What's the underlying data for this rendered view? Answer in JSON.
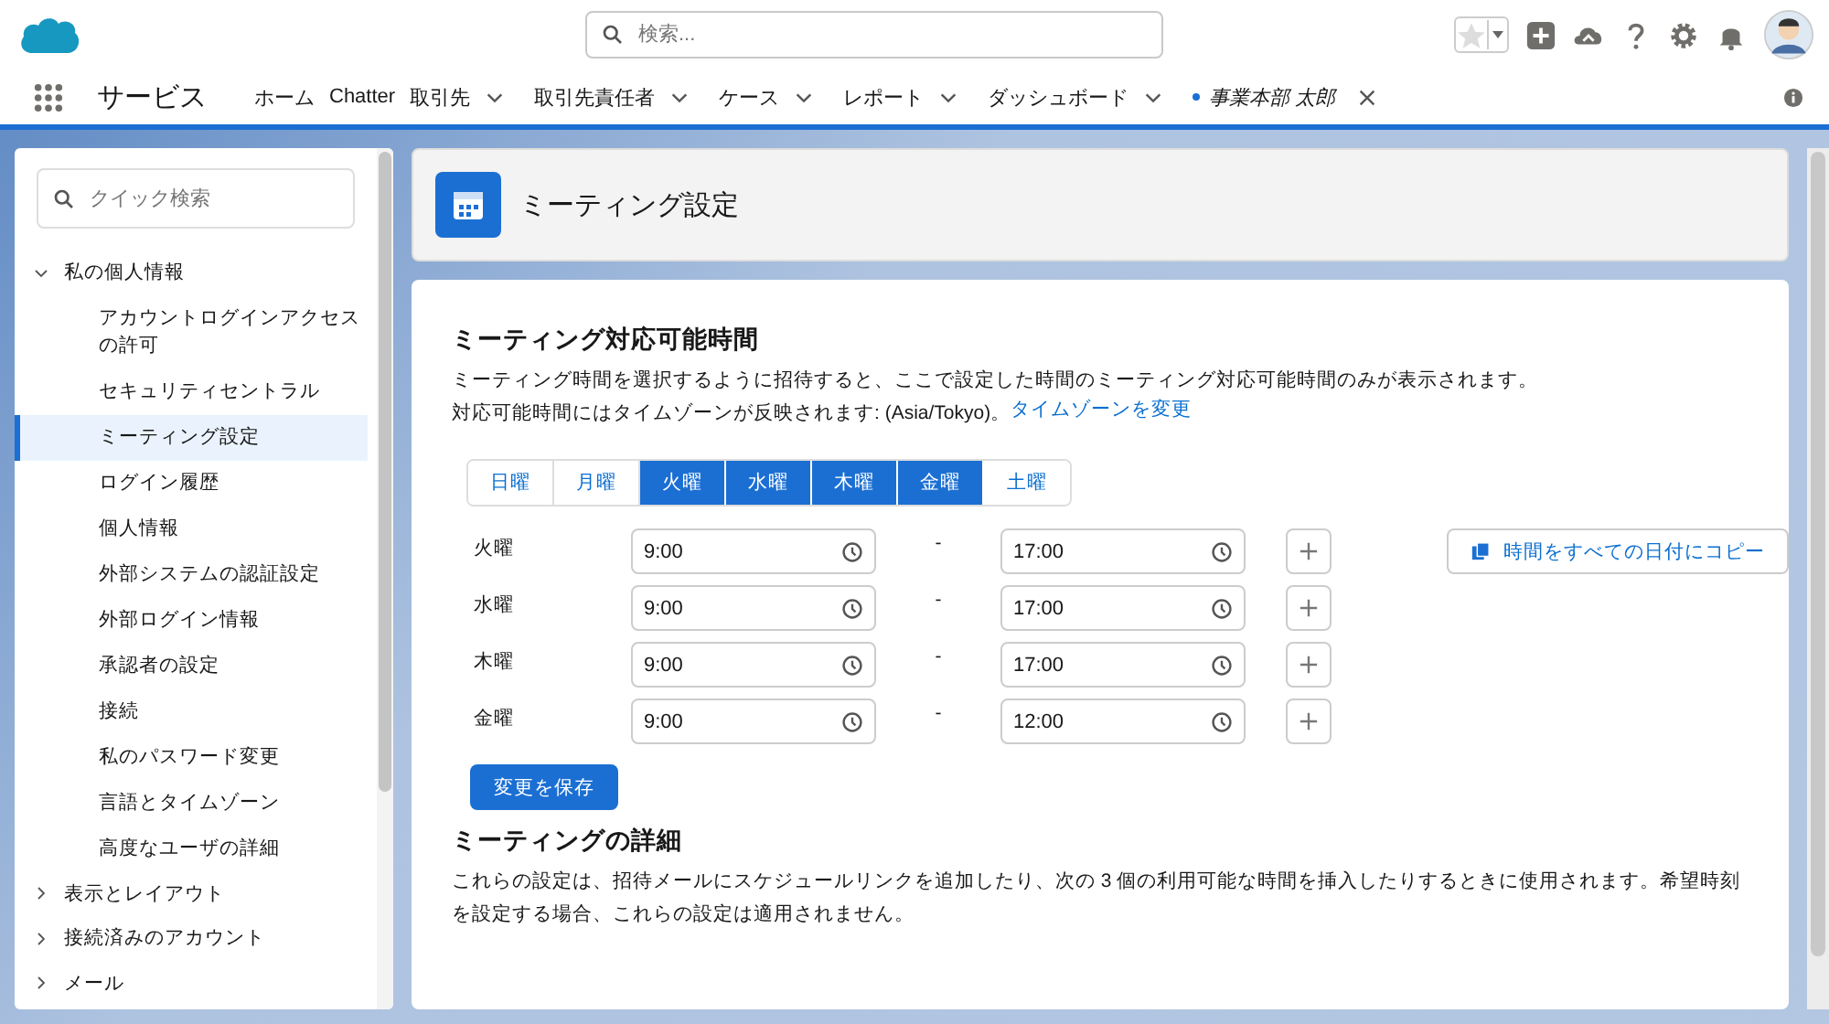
{
  "header": {
    "search": {
      "placeholder": "検索..."
    }
  },
  "nav": {
    "app_name": "サービス",
    "items": [
      {
        "label": "ホーム",
        "dropdown": false
      },
      {
        "label": "Chatter",
        "dropdown": false
      },
      {
        "label": "取引先",
        "dropdown": true
      },
      {
        "label": "取引先責任者",
        "dropdown": true
      },
      {
        "label": "ケース",
        "dropdown": true
      },
      {
        "label": "レポート",
        "dropdown": true
      },
      {
        "label": "ダッシュボード",
        "dropdown": true
      }
    ],
    "open_tab": {
      "label": "事業本部 太郎"
    }
  },
  "sidebar": {
    "search": {
      "placeholder": "クイック検索"
    },
    "tree": [
      {
        "label": "私の個人情報",
        "expanded": true,
        "children": [
          {
            "label": "アカウントログインアクセスの許可",
            "selected": false
          },
          {
            "label": "セキュリティセントラル",
            "selected": false
          },
          {
            "label": "ミーティング設定",
            "selected": true
          },
          {
            "label": "ログイン履歴",
            "selected": false
          },
          {
            "label": "個人情報",
            "selected": false
          },
          {
            "label": "外部システムの認証設定",
            "selected": false
          },
          {
            "label": "外部ログイン情報",
            "selected": false
          },
          {
            "label": "承認者の設定",
            "selected": false
          },
          {
            "label": "接続",
            "selected": false
          },
          {
            "label": "私のパスワード変更",
            "selected": false
          },
          {
            "label": "言語とタイムゾーン",
            "selected": false
          },
          {
            "label": "高度なユーザの詳細",
            "selected": false
          }
        ]
      },
      {
        "label": "表示とレイアウト",
        "expanded": false
      },
      {
        "label": "接続済みのアカウント",
        "expanded": false
      },
      {
        "label": "メール",
        "expanded": false
      }
    ]
  },
  "page_header": {
    "title": "ミーティング設定"
  },
  "availability": {
    "title": "ミーティング対応可能時間",
    "description": "ミーティング時間を選択するように招待すると、ここで設定した時間のミーティング対応可能時間のみが表示されます。",
    "timezone_note": "対応可能時間にはタイムゾーンが反映されます: (Asia/Tokyo)。",
    "timezone_link": "タイムゾーンを変更",
    "days": [
      {
        "label": "日曜",
        "selected": false
      },
      {
        "label": "月曜",
        "selected": false
      },
      {
        "label": "火曜",
        "selected": true
      },
      {
        "label": "水曜",
        "selected": true
      },
      {
        "label": "木曜",
        "selected": true
      },
      {
        "label": "金曜",
        "selected": true
      },
      {
        "label": "土曜",
        "selected": false
      }
    ],
    "rows": [
      {
        "day": "火曜",
        "start": "9:00",
        "separator": "-",
        "end": "17:00"
      },
      {
        "day": "水曜",
        "start": "9:00",
        "separator": "-",
        "end": "17:00"
      },
      {
        "day": "木曜",
        "start": "9:00",
        "separator": "-",
        "end": "17:00"
      },
      {
        "day": "金曜",
        "start": "9:00",
        "separator": "-",
        "end": "12:00"
      }
    ],
    "copy_button": "時間をすべての日付にコピー",
    "save_button": "変更を保存"
  },
  "details": {
    "title": "ミーティングの詳細",
    "description": "これらの設定は、招待メールにスケジュールリンクを追加したり、次の 3 個の利用可能な時間を挿入したりするときに使用されます。希望時刻を設定する場合、これらの設定は適用されません。"
  }
}
